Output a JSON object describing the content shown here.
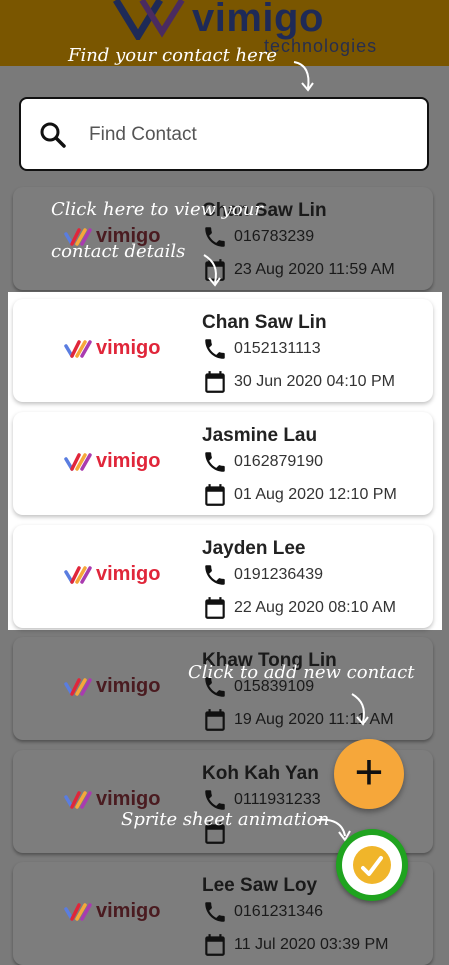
{
  "header": {
    "logo_word": "vimigo",
    "logo_sub": "technologies"
  },
  "search": {
    "placeholder": "Find Contact"
  },
  "card_logo_text": "vimigo",
  "contacts_dim_top": [
    {
      "name": "Chan Saw Lin",
      "phone": "016783239",
      "date": "23 Aug 2020 11:59 AM"
    }
  ],
  "contacts_highlight": [
    {
      "name": "Chan Saw Lin",
      "phone": "0152131113",
      "date": "30 Jun 2020 04:10 PM"
    },
    {
      "name": "Jasmine Lau",
      "phone": "0162879190",
      "date": "01 Aug 2020 12:10 PM"
    },
    {
      "name": "Jayden Lee",
      "phone": "0191236439",
      "date": "22 Aug 2020 08:10 AM"
    }
  ],
  "contacts_dim_bottom": [
    {
      "name": "Khaw Tong Lin",
      "phone": "015839109",
      "date": "19 Aug 2020 11:11 AM"
    },
    {
      "name": "Koh Kah Yan",
      "phone": "0111931233",
      "date": ""
    },
    {
      "name": "Lee Saw Loy",
      "phone": "0161231346",
      "date": "11 Jul 2020 03:39 PM"
    }
  ],
  "tips": {
    "find": "Find your contact here",
    "view": "Click here to view your",
    "view2": "contact details",
    "add": "Click to add new contact",
    "sprite": "Sprite sheet animation"
  },
  "fab": {
    "plus": "+"
  },
  "colors": {
    "accent": "#f6a73a",
    "brand_red": "#e0263a",
    "sprite_green": "#1fa31f"
  }
}
